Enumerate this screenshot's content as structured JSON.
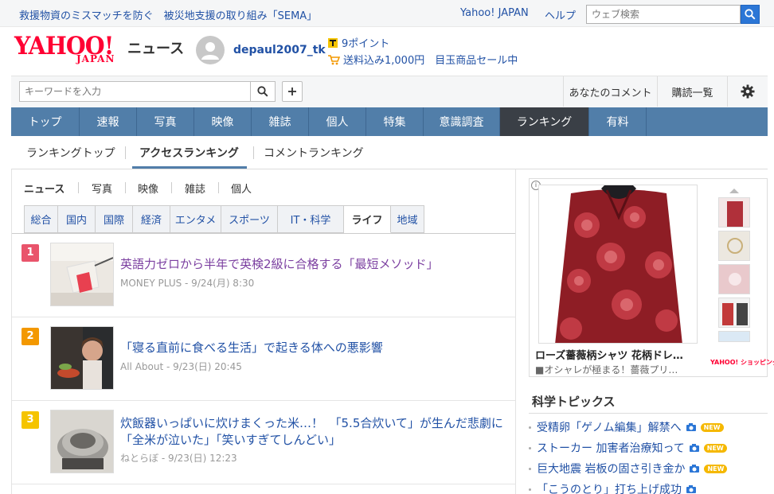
{
  "topbar": {
    "link1": "救援物資のミスマッチを防ぐ　被災地支援の取り組み「SEMA」",
    "yahoo_japan": "Yahoo! JAPAN",
    "help": "ヘルプ",
    "search_placeholder": "ウェブ検索"
  },
  "header": {
    "logo_main": "YAHOO!",
    "logo_sub": "JAPAN",
    "service": "ニュース",
    "username": "depaul2007_tk",
    "points": "9ポイント",
    "shipping": "送料込み1,000円　目玉商品セール中"
  },
  "search": {
    "placeholder": "キーワードを入力",
    "my_comments": "あなたのコメント",
    "subscriptions": "購読一覧"
  },
  "gnav": [
    {
      "label": "トップ",
      "w": 86
    },
    {
      "label": "速報",
      "w": 72
    },
    {
      "label": "写真",
      "w": 72
    },
    {
      "label": "映像",
      "w": 72
    },
    {
      "label": "雑誌",
      "w": 72
    },
    {
      "label": "個人",
      "w": 72
    },
    {
      "label": "特集",
      "w": 72
    },
    {
      "label": "意識調査",
      "w": 96
    },
    {
      "label": "ランキング",
      "w": 112,
      "active": true
    },
    {
      "label": "有料",
      "w": 72
    }
  ],
  "subnav": {
    "tab1": "ランキングトップ",
    "tab2": "アクセスランキング",
    "tab3": "コメントランキング"
  },
  "categories": {
    "c1": "ニュース",
    "c2": "写真",
    "c3": "映像",
    "c4": "雑誌",
    "c5": "個人"
  },
  "genres": [
    {
      "label": "総合",
      "w": 43
    },
    {
      "label": "国内",
      "w": 47
    },
    {
      "label": "国際",
      "w": 47
    },
    {
      "label": "経済",
      "w": 47
    },
    {
      "label": "エンタメ",
      "w": 64
    },
    {
      "label": "スポーツ",
      "w": 71
    },
    {
      "label": "IT・科学",
      "w": 83
    },
    {
      "label": "ライフ",
      "w": 59,
      "active": true
    },
    {
      "label": "地域",
      "w": 42
    }
  ],
  "ranking": [
    {
      "rank": "1",
      "color": "#e9546b",
      "title": "英語力ゼロから半年で英検2級に合格する「最短メソッド」",
      "meta": "MONEY PLUS - 9/24(月) 8:30",
      "title_color": "#7b3fa0"
    },
    {
      "rank": "2",
      "color": "#f39800",
      "title": "「寝る直前に食べる生活」で起きる体への悪影響",
      "meta": "All About - 9/23(日) 20:45",
      "title_color": "#2151a5"
    },
    {
      "rank": "3",
      "color": "#f5c400",
      "title": "炊飯器いっぱいに炊けまくった米…！　「5.5合炊いて」が生んだ悲劇に「全米が泣いた」「笑いすぎてしんどい」",
      "meta": "ねとらぼ - 9/23(日) 12:23",
      "title_color": "#2151a5"
    }
  ],
  "ad": {
    "title": "ローズ薔薇柄シャツ 花柄ドレ…",
    "desc": "■オシャレが極まる！薔薇プリ…",
    "brand": "YAHOO! ショッピング"
  },
  "science": {
    "heading": "科学トピックス",
    "topics": [
      {
        "label": "受精卵「ゲノム編集」解禁へ",
        "new": "NEW"
      },
      {
        "label": "ストーカー 加害者治療知って",
        "new": "NEW"
      },
      {
        "label": "巨大地震 岩板の固さ引き金か",
        "new": "NEW"
      },
      {
        "label": "「こうのとり」打ち上げ成功",
        "new": ""
      }
    ]
  }
}
